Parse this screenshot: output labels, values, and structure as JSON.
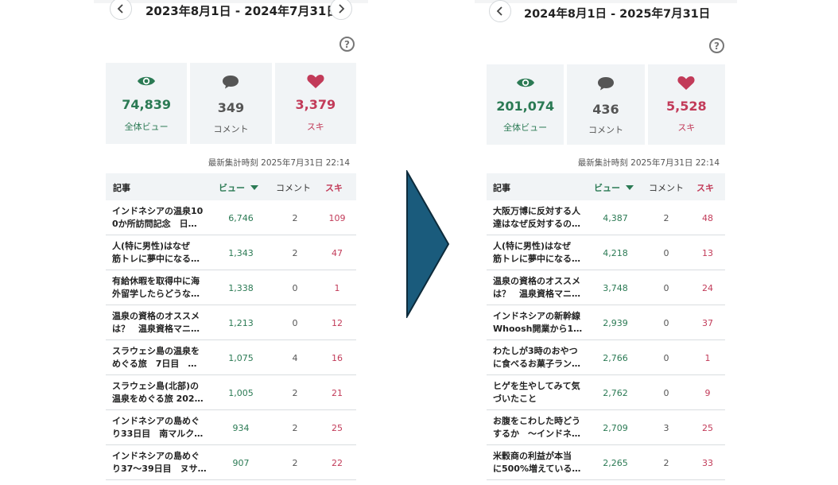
{
  "left": {
    "date_range": "2023年8月1日 - 2024年7月31日",
    "stats": {
      "views": "74,839",
      "views_label": "全体ビュー",
      "comments": "349",
      "comments_label": "コメント",
      "likes": "3,379",
      "likes_label": "スキ"
    },
    "updated": "最新集計時刻 2025年7月31日 22:14",
    "headers": {
      "article": "記事",
      "views": "ビュー",
      "comments": "コメント",
      "likes": "スキ"
    },
    "rows": [
      {
        "title1": "インドネシアの温泉10",
        "title2": "0か所訪問記念　日…",
        "views": "6,746",
        "comments": "2",
        "likes": "109"
      },
      {
        "title1": "人(特に男性)はなぜ",
        "title2": "筋トレに夢中になる…",
        "views": "1,343",
        "comments": "2",
        "likes": "47"
      },
      {
        "title1": "有給休暇を取得中に海",
        "title2": "外留学したらどうな…",
        "views": "1,338",
        "comments": "0",
        "likes": "1"
      },
      {
        "title1": "温泉の資格のオススメ",
        "title2": "は？　温泉資格マニ…",
        "views": "1,213",
        "comments": "0",
        "likes": "12"
      },
      {
        "title1": "スラウェシ島の温泉を",
        "title2": "めぐる旅　7日目　…",
        "views": "1,075",
        "comments": "4",
        "likes": "16"
      },
      {
        "title1": "スラウェシ島(北部)の",
        "title2": "温泉をめぐる旅 202…",
        "views": "1,005",
        "comments": "2",
        "likes": "21"
      },
      {
        "title1": "インドネシアの島めぐ",
        "title2": "り33日目　南マルク…",
        "views": "934",
        "comments": "2",
        "likes": "25"
      },
      {
        "title1": "インドネシアの島めぐ",
        "title2": "り37〜39日目　ヌサ…",
        "views": "907",
        "comments": "2",
        "likes": "22"
      }
    ]
  },
  "right": {
    "date_range": "2024年8月1日 - 2025年7月31日",
    "stats": {
      "views": "201,074",
      "views_label": "全体ビュー",
      "comments": "436",
      "comments_label": "コメント",
      "likes": "5,528",
      "likes_label": "スキ"
    },
    "updated": "最新集計時刻 2025年7月31日 22:14",
    "headers": {
      "article": "記事",
      "views": "ビュー",
      "comments": "コメント",
      "likes": "スキ"
    },
    "rows": [
      {
        "title1": "大阪万博に反対する人",
        "title2": "達はなぜ反対するの…",
        "views": "4,387",
        "comments": "2",
        "likes": "48"
      },
      {
        "title1": "人(特に男性)はなぜ",
        "title2": "筋トレに夢中になる…",
        "views": "4,218",
        "comments": "0",
        "likes": "13"
      },
      {
        "title1": "温泉の資格のオススメ",
        "title2": "は？　温泉資格マニ…",
        "views": "3,748",
        "comments": "0",
        "likes": "24"
      },
      {
        "title1": "インドネシアの新幹線",
        "title2": "Whoosh開業から1…",
        "views": "2,939",
        "comments": "0",
        "likes": "37"
      },
      {
        "title1": "わたしが3時のおやつ",
        "title2": "に食べるお菓子ラン…",
        "views": "2,766",
        "comments": "0",
        "likes": "1"
      },
      {
        "title1": "ヒゲを生やしてみて気",
        "title2": "づいたこと",
        "views": "2,762",
        "comments": "0",
        "likes": "9"
      },
      {
        "title1": "お腹をこわした時どう",
        "title2": "するか　〜インドネ…",
        "views": "2,709",
        "comments": "3",
        "likes": "25"
      },
      {
        "title1": "米穀商の利益が本当",
        "title2": "に500%増えている…",
        "views": "2,265",
        "comments": "2",
        "likes": "33"
      }
    ]
  },
  "colors": {
    "views": "#2b7a54",
    "likes": "#c23b59",
    "arrow": "#1a5b7c"
  }
}
